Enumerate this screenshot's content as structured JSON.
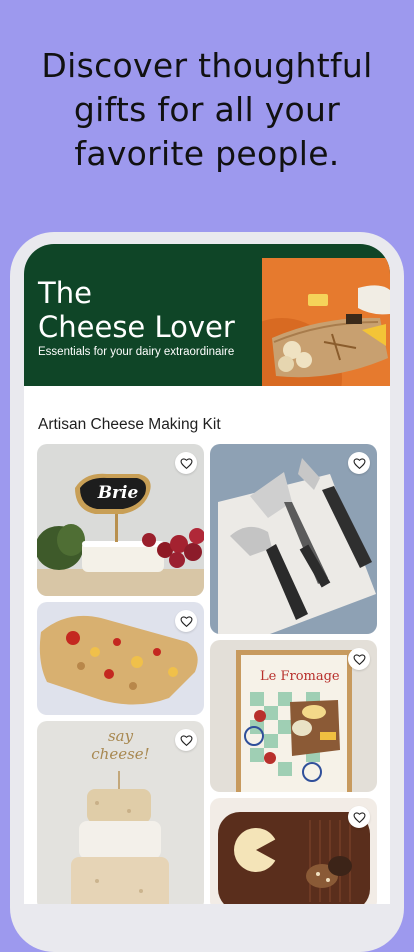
{
  "headline": {
    "line1": "Discover thoughtful",
    "line2": "gifts for all your",
    "line3": "favorite people."
  },
  "hero": {
    "title_line1": "The",
    "title_line2": "Cheese Lover",
    "subtitle": "Essentials for your dairy extraordinaire",
    "background_color": "#0f4527"
  },
  "section": {
    "title": "Artisan Cheese Making Kit"
  },
  "listings": [
    {
      "icon": "heart-icon",
      "sign_text": "Brie"
    },
    {
      "icon": "heart-icon"
    },
    {
      "icon": "heart-icon"
    },
    {
      "icon": "heart-icon",
      "poster_text": "Le Fromage"
    },
    {
      "icon": "heart-icon",
      "topper_line1": "say",
      "topper_line2": "cheese!"
    },
    {
      "icon": "heart-icon"
    }
  ]
}
